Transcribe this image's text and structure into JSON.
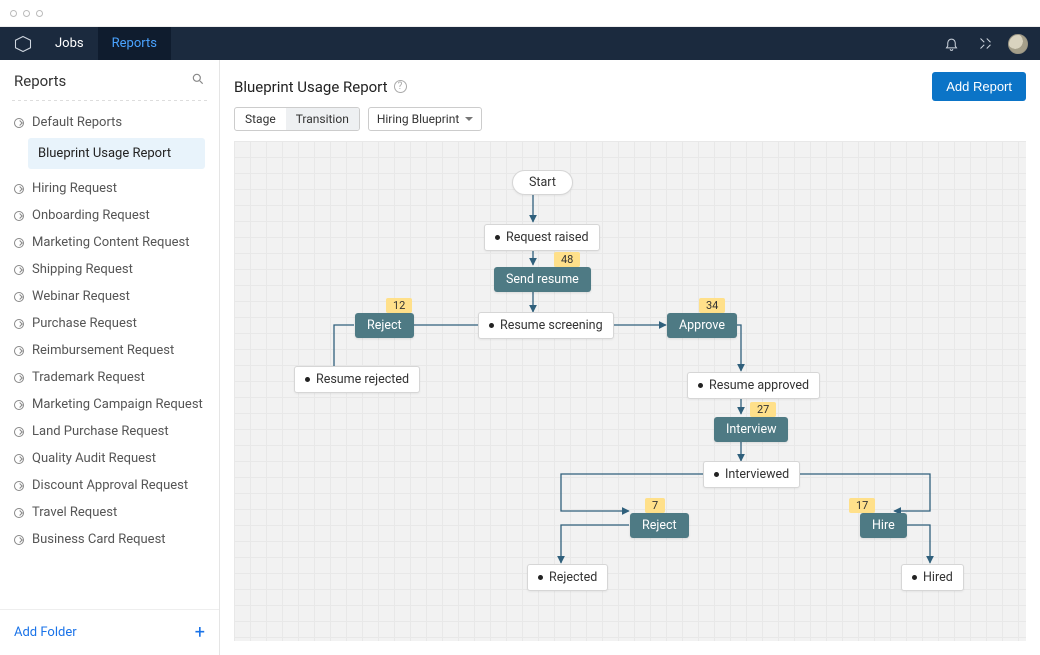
{
  "topnav": {
    "items": [
      {
        "label": "Jobs",
        "active": false
      },
      {
        "label": "Reports",
        "active": true
      }
    ]
  },
  "sidebar": {
    "title": "Reports",
    "items": [
      {
        "label": "Default Reports",
        "children": [
          {
            "label": "Blueprint Usage Report",
            "selected": true
          }
        ]
      },
      {
        "label": "Hiring Request"
      },
      {
        "label": "Onboarding Request"
      },
      {
        "label": "Marketing Content Request"
      },
      {
        "label": "Shipping Request"
      },
      {
        "label": "Webinar Request"
      },
      {
        "label": "Purchase Request"
      },
      {
        "label": "Reimbursement Request"
      },
      {
        "label": "Trademark Request"
      },
      {
        "label": "Marketing Campaign Request"
      },
      {
        "label": "Land Purchase Request"
      },
      {
        "label": "Quality Audit Request"
      },
      {
        "label": "Discount Approval Request"
      },
      {
        "label": "Travel Request"
      },
      {
        "label": "Business Card Request"
      }
    ],
    "add_folder": "Add Folder"
  },
  "header": {
    "title": "Blueprint Usage Report",
    "add_report": "Add Report",
    "segment": {
      "stage": "Stage",
      "transition": "Transition",
      "active": "transition"
    },
    "dropdown": "Hiring Blueprint"
  },
  "states": {
    "start": "Start",
    "request_raised": "Request raised",
    "resume_screening": "Resume screening",
    "resume_rejected": "Resume rejected",
    "resume_approved": "Resume approved",
    "interviewed": "Interviewed",
    "rejected": "Rejected",
    "hired": "Hired"
  },
  "transitions": {
    "send_resume": {
      "label": "Send resume",
      "count": "48"
    },
    "reject1": {
      "label": "Reject",
      "count": "12"
    },
    "approve": {
      "label": "Approve",
      "count": "34"
    },
    "interview": {
      "label": "Interview",
      "count": "27"
    },
    "reject2": {
      "label": "Reject",
      "count": "7"
    },
    "hire": {
      "label": "Hire",
      "count": "17"
    }
  }
}
